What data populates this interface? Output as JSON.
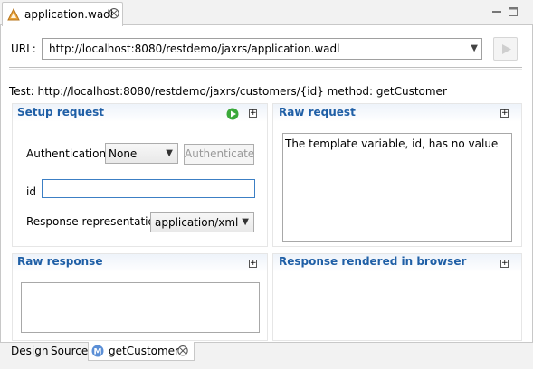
{
  "editor_tab": {
    "title": "application.wadl",
    "close_glyph": "⨂"
  },
  "url_bar": {
    "label": "URL:",
    "value": "http://localhost:8080/restdemo/jaxrs/application.wadl"
  },
  "test_info": "Test: http://localhost:8080/restdemo/jaxrs/customers/{id} method: getCustomer",
  "setup_request": {
    "title": "Setup request",
    "authentication_label": "Authentication:",
    "authentication_value": "None",
    "authenticate_button": "Authenticate",
    "id_label": "id",
    "id_value": "",
    "response_representation_label": "Response representation:",
    "response_representation_value": "application/xml"
  },
  "raw_request": {
    "title": "Raw request",
    "content": "The template variable, id, has no value"
  },
  "raw_response": {
    "title": "Raw response",
    "content": ""
  },
  "rendered_response": {
    "title": "Response rendered in browser"
  },
  "bottom_tabs": {
    "design": "Design",
    "source": "Source",
    "get_customer": "getCustomer",
    "close_glyph": "⨂"
  },
  "colors": {
    "section_title": "#1f5fa6",
    "run_icon": "#3aa93a",
    "focus_border": "#3c7fc4"
  }
}
